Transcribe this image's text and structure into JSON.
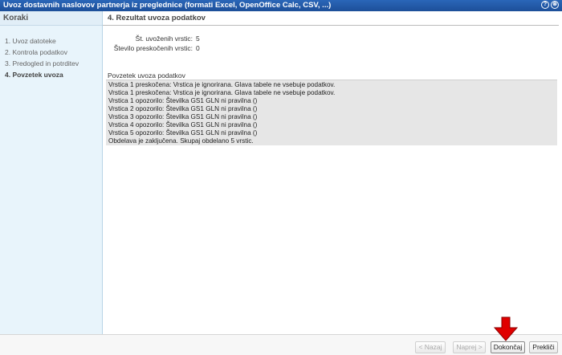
{
  "window": {
    "title": "Uvoz dostavnih naslovov partnerja iz preglednice (formati Excel, OpenOffice Calc, CSV, ...)",
    "help_icon": "?",
    "close_icon": "⊗"
  },
  "sidebar": {
    "title": "Koraki",
    "steps": [
      {
        "label": "1. Uvoz datoteke",
        "active": false
      },
      {
        "label": "2. Kontrola podatkov",
        "active": false
      },
      {
        "label": "3. Predogled in potrditev",
        "active": false
      },
      {
        "label": "4. Povzetek uvoza",
        "active": true
      }
    ]
  },
  "main": {
    "title": "4. Rezultat uvoza podatkov",
    "stats": [
      {
        "label": "Št. uvoženih vrstic:",
        "value": "5"
      },
      {
        "label": "Število preskočenih vrstic:",
        "value": "0"
      }
    ],
    "summary_label": "Povzetek uvoza podatkov",
    "summary_lines": [
      "Vrstica 1 preskočena: Vrstica je ignorirana. Glava tabele ne vsebuje podatkov.",
      "Vrstica 1 preskočena: Vrstica je ignorirana. Glava tabele ne vsebuje podatkov.",
      "Vrstica 1 opozorilo: Številka GS1 GLN ni pravilna ()",
      "Vrstica 2 opozorilo: Številka GS1 GLN ni pravilna ()",
      "Vrstica 3 opozorilo: Številka GS1 GLN ni pravilna ()",
      "Vrstica 4 opozorilo: Številka GS1 GLN ni pravilna ()",
      "Vrstica 5 opozorilo: Številka GS1 GLN ni pravilna ()",
      "Obdelava je zaključena. Skupaj obdelano 5 vrstic."
    ]
  },
  "footer": {
    "back_label": "< Nazaj",
    "next_label": "Naprej >",
    "finish_label": "Dokončaj",
    "cancel_label": "Prekliči"
  },
  "colors": {
    "titlebar": "#1d4f99",
    "sidebar_bg": "#e8f4fb",
    "summary_bg": "#e6e6e6",
    "arrow": "#e00000"
  }
}
